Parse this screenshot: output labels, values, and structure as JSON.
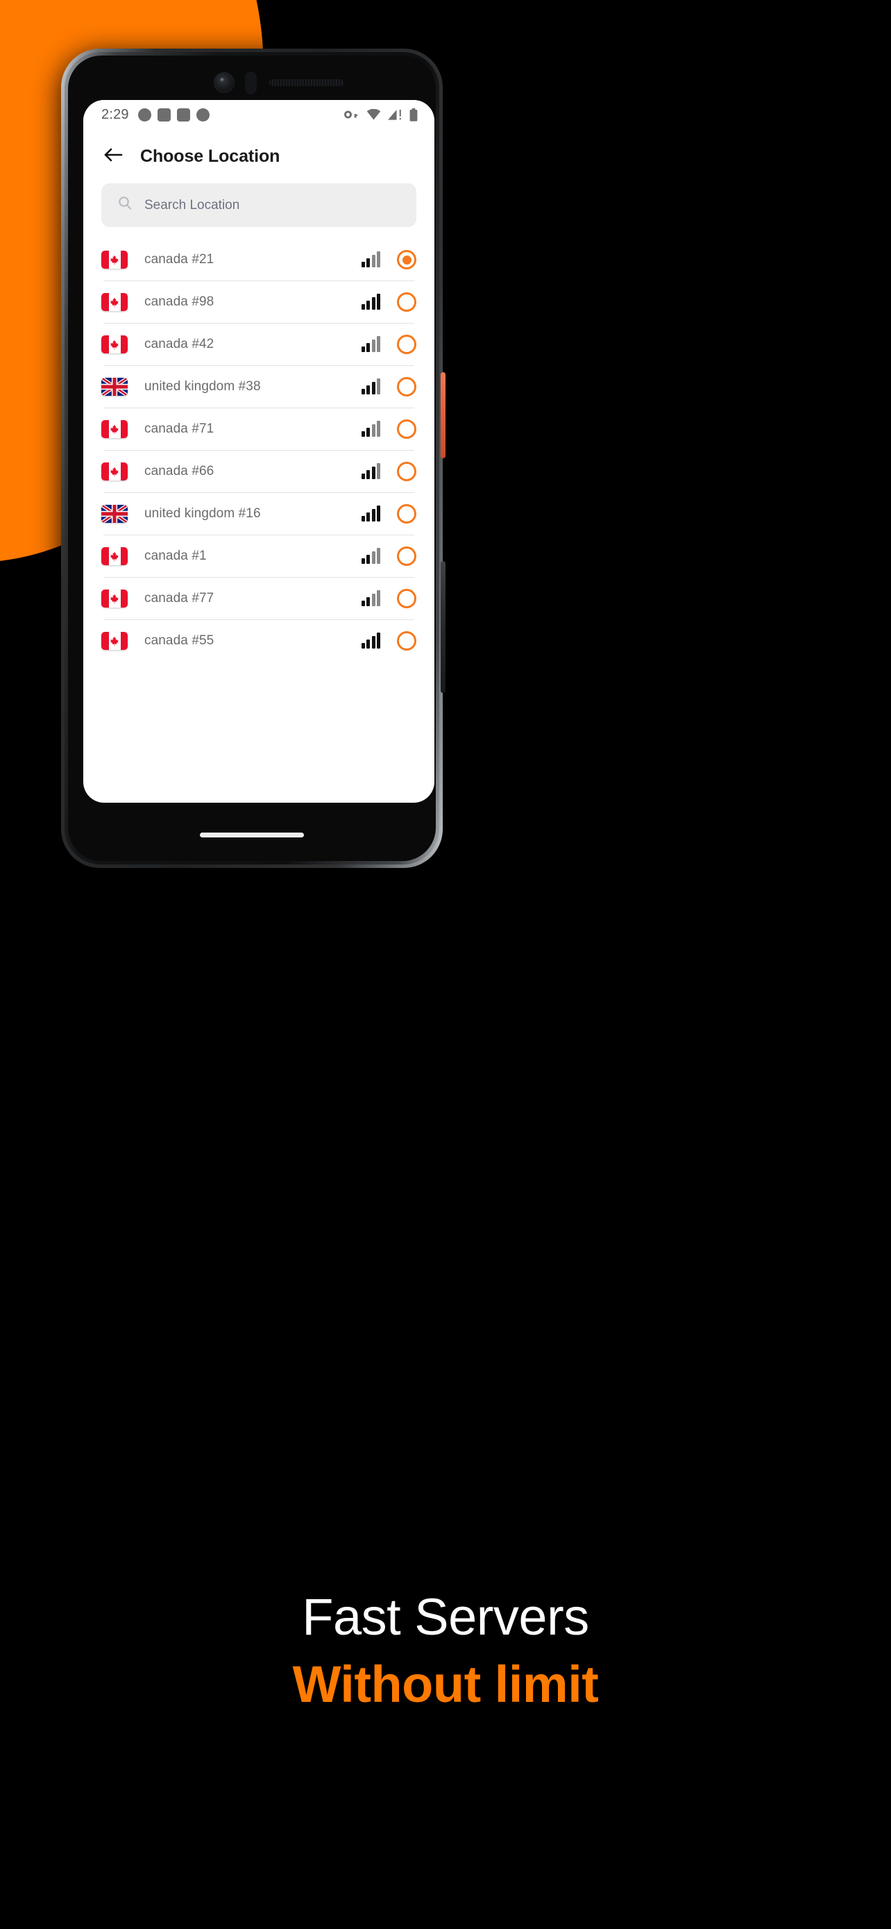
{
  "statusbar": {
    "time": "2:29",
    "notification_icons": [
      "circle-icon",
      "square-icon",
      "square-icon",
      "circle-icon"
    ],
    "system_icons": [
      "vpn-key-icon",
      "wifi-icon",
      "cell-signal-warning-icon",
      "battery-icon"
    ]
  },
  "appbar": {
    "back_icon": "arrow-left-icon",
    "title": "Choose Location"
  },
  "search": {
    "icon": "search-icon",
    "placeholder": "Search Location",
    "value": ""
  },
  "colors": {
    "accent": "#FF7A00",
    "radio": "#F5791E",
    "search_bg": "#EEEEEE",
    "divider": "#E2E2E2",
    "label": "#6B6B6B",
    "background": "#000000"
  },
  "servers": [
    {
      "flag": "canada-flag-icon",
      "country": "ca",
      "label": "canada #21",
      "signal": 2,
      "selected": true
    },
    {
      "flag": "canada-flag-icon",
      "country": "ca",
      "label": "canada #98",
      "signal": 4,
      "selected": false
    },
    {
      "flag": "canada-flag-icon",
      "country": "ca",
      "label": "canada #42",
      "signal": 2,
      "selected": false
    },
    {
      "flag": "united-kingdom-flag-icon",
      "country": "uk",
      "label": "united kingdom #38",
      "signal": 3,
      "selected": false
    },
    {
      "flag": "canada-flag-icon",
      "country": "ca",
      "label": "canada #71",
      "signal": 2,
      "selected": false
    },
    {
      "flag": "canada-flag-icon",
      "country": "ca",
      "label": "canada #66",
      "signal": 3,
      "selected": false
    },
    {
      "flag": "united-kingdom-flag-icon",
      "country": "uk",
      "label": "united kingdom #16",
      "signal": 4,
      "selected": false
    },
    {
      "flag": "canada-flag-icon",
      "country": "ca",
      "label": "canada #1",
      "signal": 2,
      "selected": false
    },
    {
      "flag": "canada-flag-icon",
      "country": "ca",
      "label": "canada #77",
      "signal": 2,
      "selected": false
    },
    {
      "flag": "canada-flag-icon",
      "country": "ca",
      "label": "canada #55",
      "signal": 4,
      "selected": false
    }
  ],
  "signal_max": 4,
  "device": {
    "home_indicator": "home-indicator",
    "power_button": "power-button",
    "volume_button": "volume-button",
    "front_camera": "front-camera-icon",
    "proximity_sensor": "proximity-sensor-icon",
    "earpiece": "earpiece-speaker-icon"
  },
  "caption": {
    "line1": "Fast Servers",
    "line2": "Without limit"
  }
}
